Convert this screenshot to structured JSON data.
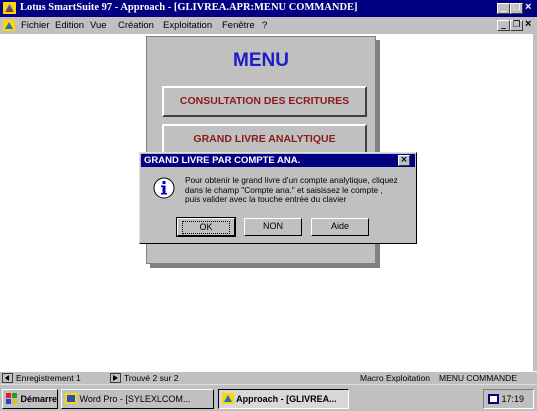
{
  "window": {
    "title": "Lotus SmartSuite 97  -  Approach - [GLIVREA.APR:MENU COMMANDE]",
    "controls": {
      "minimize": "_",
      "maximize": "1",
      "close": "×"
    }
  },
  "menubar": {
    "items": [
      "Fichier",
      "Edition",
      "Vue",
      "Création",
      "Exploitation",
      "Fenêtre",
      "?"
    ]
  },
  "form": {
    "title": "MENU",
    "buttons": [
      "CONSULTATION DES ECRITURES",
      "GRAND LIVRE ANALYTIQUE"
    ]
  },
  "dialog": {
    "title": "GRAND LIVRE PAR COMPTE ANA.",
    "message": "Pour obtenir le grand livre d'un compte analytique, cliquez\ndans le champ \"Compte ana.\" et saisissez le compte ,\npuis valider avec la touche entrée du clavier",
    "icon": "info-icon",
    "buttons": {
      "ok": "OK",
      "non": "NON",
      "aide": "Aide"
    }
  },
  "statusbar": {
    "record": "Enregistrement 1",
    "found": "Trouvé 2 sur 2",
    "macro": "Macro Exploitation",
    "view": "MENU COMMANDE"
  },
  "taskbar": {
    "start": "Démarrer",
    "tasks": [
      "Word Pro - [SYLEXLCOM...",
      "Approach - [GLIVREA..."
    ],
    "clock": "17:19"
  },
  "colors": {
    "titlebar": "#000080",
    "menu_title": "#1c1cc8",
    "big_button_text": "#8b1a1a"
  }
}
